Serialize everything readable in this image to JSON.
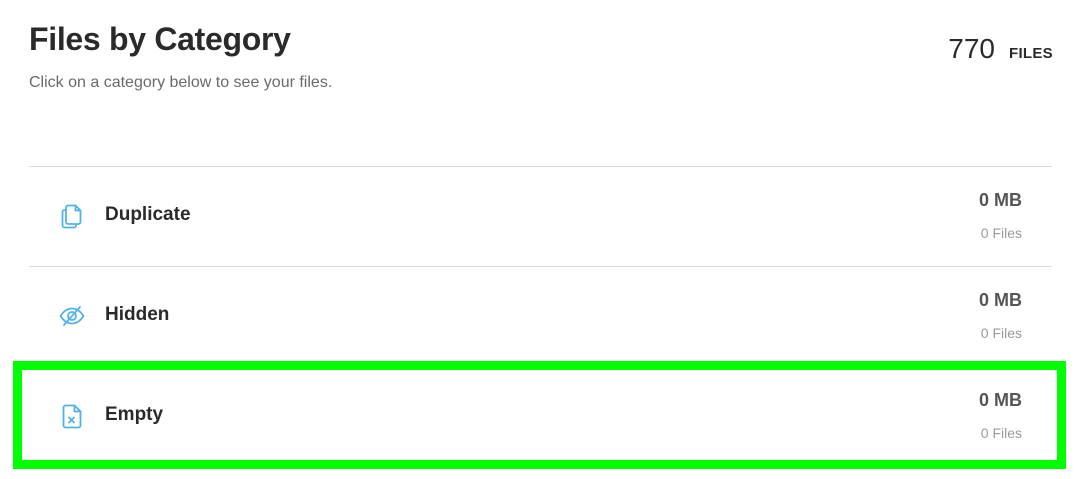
{
  "header": {
    "title": "Files by Category",
    "subtitle": "Click on a category below to see your files.",
    "total_count": "770",
    "total_unit": "FILES"
  },
  "colors": {
    "icon_accent": "#4fb3e8",
    "highlight": "#00ff00"
  },
  "categories": [
    {
      "label": "Duplicate",
      "icon": "duplicate-icon",
      "size": "0 MB",
      "count": "0 Files"
    },
    {
      "label": "Hidden",
      "icon": "hidden-eye-icon",
      "size": "0 MB",
      "count": "0 Files"
    },
    {
      "label": "Empty",
      "icon": "empty-file-icon",
      "size": "0 MB",
      "count": "0 Files",
      "highlighted": true
    }
  ]
}
